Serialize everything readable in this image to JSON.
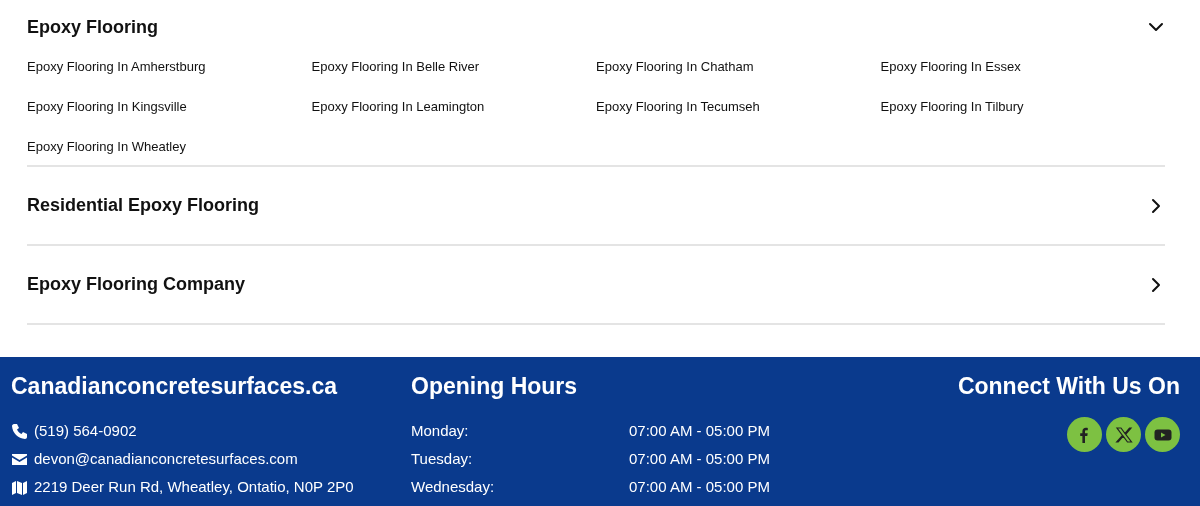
{
  "accordion": [
    {
      "title": "Epoxy Flooring",
      "expanded": true,
      "links": [
        "Epoxy Flooring In Amherstburg",
        "Epoxy Flooring In Belle River",
        "Epoxy Flooring In Chatham",
        "Epoxy Flooring In Essex",
        "Epoxy Flooring In Kingsville",
        "Epoxy Flooring In Leamington",
        "Epoxy Flooring In Tecumseh",
        "Epoxy Flooring In Tilbury",
        "Epoxy Flooring In Wheatley"
      ]
    },
    {
      "title": "Residential Epoxy Flooring",
      "expanded": false
    },
    {
      "title": "Epoxy Flooring Company",
      "expanded": false
    }
  ],
  "footer": {
    "site_title": "Canadianconcretesurfaces.ca",
    "contacts": [
      {
        "kind": "phone",
        "text": "(519) 564-0902"
      },
      {
        "kind": "email",
        "text": "devon@canadianconcretesurfaces.com"
      },
      {
        "kind": "map",
        "text": "2219 Deer Run Rd, Wheatley, Ontatio, N0P 2P0"
      }
    ],
    "hours_title": "Opening Hours",
    "hours": [
      {
        "day": "Monday:",
        "time": "07:00 AM - 05:00 PM"
      },
      {
        "day": "Tuesday:",
        "time": "07:00 AM - 05:00 PM"
      },
      {
        "day": "Wednesday:",
        "time": "07:00 AM - 05:00 PM"
      }
    ],
    "social_title": "Connect With Us On",
    "social": [
      {
        "kind": "facebook"
      },
      {
        "kind": "x"
      },
      {
        "kind": "youtube"
      }
    ]
  }
}
